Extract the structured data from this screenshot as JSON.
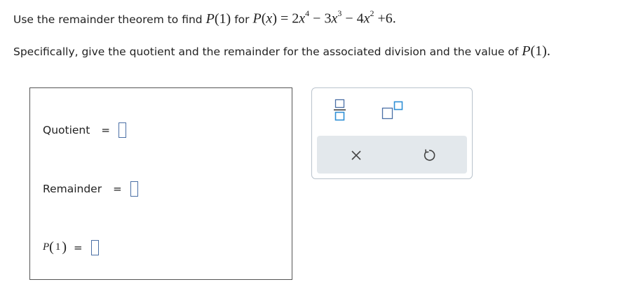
{
  "question": {
    "line1_text": "Use the remainder theorem to find",
    "line1_mid": "for",
    "line2_text": "Specifically, give the quotient and the remainder for the associated division and the value of"
  },
  "math": {
    "p": "P",
    "one": "1",
    "x": "x",
    "coef1": "2",
    "exp1": "4",
    "coef2": "3",
    "exp2": "3",
    "coef3": "4",
    "exp3": "2",
    "constant": "6"
  },
  "answers": {
    "quotient_label": "Quotient",
    "remainder_label": "Remainder",
    "equals": "=",
    "p1_p": "P",
    "p1_arg": "1",
    "quotient_value": "",
    "remainder_value": "",
    "p1_value": ""
  },
  "toolbar": {
    "buttons": [
      "fraction-icon",
      "exponent-icon",
      "close-icon",
      "reset-icon"
    ],
    "accent_color": "#2f8fd6",
    "box_color": "#4a6fa5",
    "panel_color": "#e3e8ec"
  }
}
